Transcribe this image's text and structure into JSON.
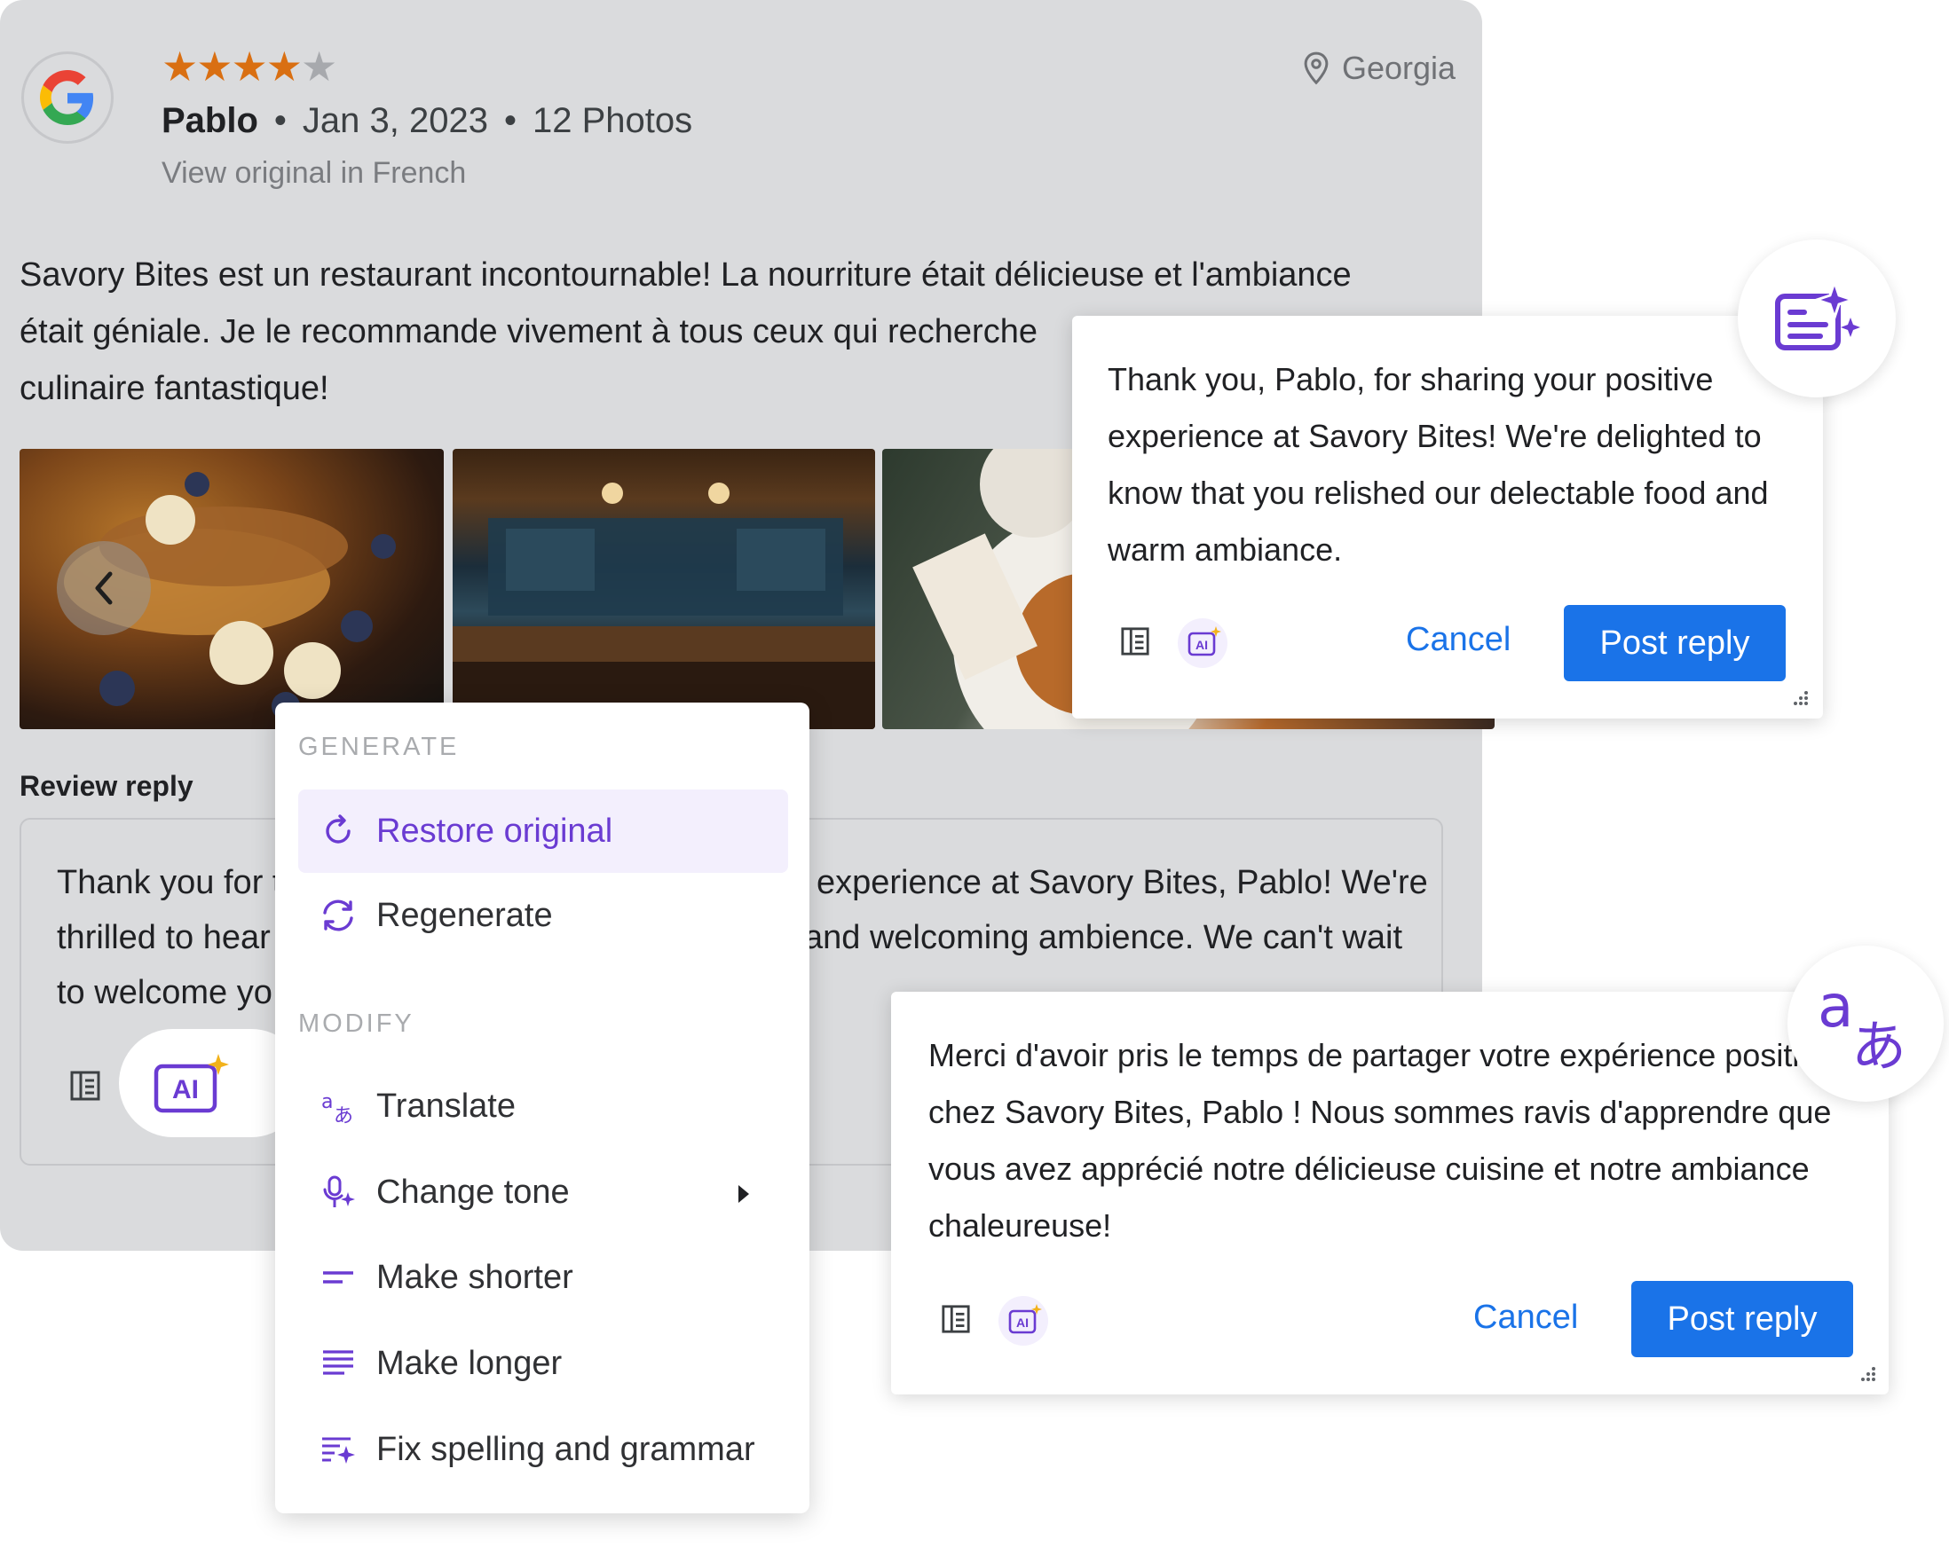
{
  "colors": {
    "accent_purple": "#6a3bd2",
    "primary_blue": "#1a73e8",
    "star_orange": "#d96f12",
    "card_gray": "#dadbdd"
  },
  "review": {
    "platform_icon": "google-logo-icon",
    "rating": 4,
    "rating_max": 5,
    "reviewer": "Pablo",
    "separator": "•",
    "date": "Jan 3, 2023",
    "photos": "12 Photos",
    "view_original": "View original in French",
    "location": "Georgia",
    "text": "Savory Bites est un restaurant incontournable! La nourriture était délicieuse et l'ambiance était géniale. Je le recommande vivement à tous ceux qui recherchent une expérience culinaire fantastique!",
    "text_visible": [
      "Savory Bites est un restaurant incontournable! La nourriture était délicieuse et l'ambiance",
      "était géniale. Je le recommande vivement à tous ceux qui recherche",
      "culinaire fantastique!"
    ]
  },
  "reply": {
    "heading": "Review reply",
    "lines": {
      "l1a": "Thank you for t",
      "l1b": "experience at Savory Bites, Pablo! We're",
      "l2a": "thrilled to hear",
      "l2b": "and welcoming ambience. We can't wait",
      "l3a": "to welcome yo"
    },
    "ai_label": "AI"
  },
  "menu": {
    "generate_header": "GENERATE",
    "modify_header": "MODIFY",
    "items": [
      {
        "label": "Restore original",
        "icon": "restore-icon"
      },
      {
        "label": "Regenerate",
        "icon": "regenerate-icon"
      },
      {
        "label": "Translate",
        "icon": "translate-icon"
      },
      {
        "label": "Change tone",
        "icon": "change-tone-icon"
      },
      {
        "label": "Make shorter",
        "icon": "make-shorter-icon"
      },
      {
        "label": "Make longer",
        "icon": "make-longer-icon"
      },
      {
        "label": "Fix spelling and grammar",
        "icon": "fix-spelling-icon"
      }
    ]
  },
  "panel_en": {
    "text": "Thank you, Pablo, for sharing your positive experience at Savory Bites! We're delighted to know that you relished our delectable food and warm ambiance.",
    "ai_label": "AI",
    "cancel": "Cancel",
    "post": "Post reply"
  },
  "panel_fr": {
    "text": "Merci d'avoir pris le temps de partager votre expérience positive chez Savory Bites, Pablo ! Nous sommes ravis d'apprendre que vous avez apprécié notre délicieuse cuisine et notre ambiance chaleureuse!",
    "ai_label": "AI",
    "cancel": "Cancel",
    "post": "Post reply"
  },
  "badges": {
    "translate_a": "a",
    "translate_jp": "あ",
    "translate_small_a": "a",
    "translate_small_jp": "あ"
  }
}
